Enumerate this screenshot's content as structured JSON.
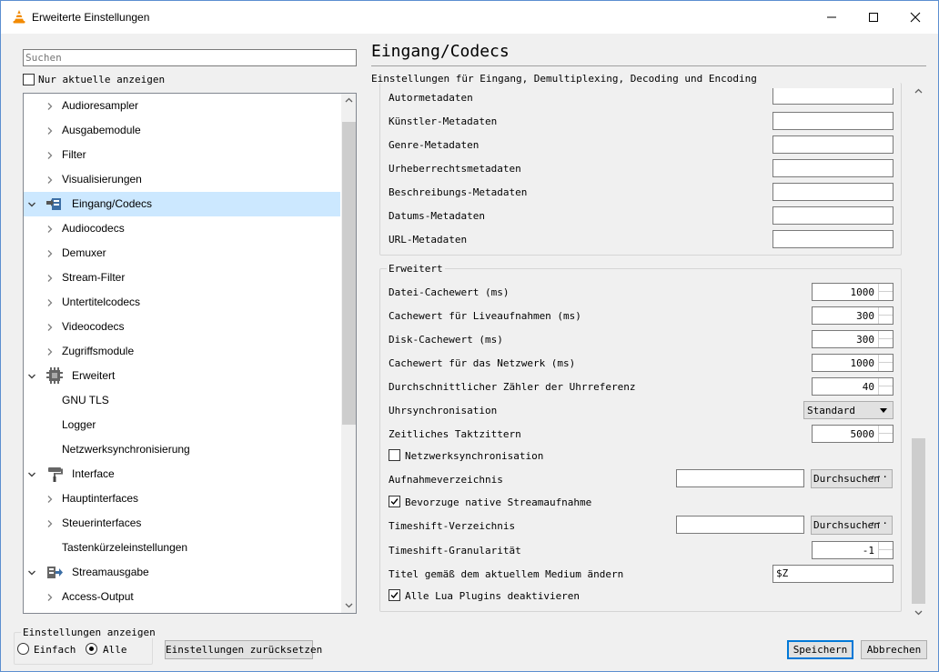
{
  "window": {
    "title": "Erweiterte Einstellungen"
  },
  "left": {
    "search_placeholder": "Suchen",
    "only_current_label": "Nur aktuelle anzeigen",
    "only_current_checked": false,
    "tree": [
      {
        "label": "Audioresampler",
        "level": 1,
        "expander": "collapsed",
        "icon": ""
      },
      {
        "label": "Ausgabemodule",
        "level": 1,
        "expander": "collapsed",
        "icon": ""
      },
      {
        "label": "Filter",
        "level": 1,
        "expander": "collapsed",
        "icon": ""
      },
      {
        "label": "Visualisierungen",
        "level": 1,
        "expander": "collapsed",
        "icon": ""
      },
      {
        "label": "Eingang/Codecs",
        "level": 0,
        "expander": "expanded",
        "icon": "input-codecs-icon",
        "selected": true
      },
      {
        "label": "Audiocodecs",
        "level": 1,
        "expander": "collapsed",
        "icon": ""
      },
      {
        "label": "Demuxer",
        "level": 1,
        "expander": "collapsed",
        "icon": ""
      },
      {
        "label": "Stream-Filter",
        "level": 1,
        "expander": "collapsed",
        "icon": ""
      },
      {
        "label": "Untertitelcodecs",
        "level": 1,
        "expander": "collapsed",
        "icon": ""
      },
      {
        "label": "Videocodecs",
        "level": 1,
        "expander": "collapsed",
        "icon": ""
      },
      {
        "label": "Zugriffsmodule",
        "level": 1,
        "expander": "collapsed",
        "icon": ""
      },
      {
        "label": "Erweitert",
        "level": 0,
        "expander": "expanded",
        "icon": "chip-icon"
      },
      {
        "label": "GNU TLS",
        "level": 1,
        "expander": "none",
        "icon": ""
      },
      {
        "label": "Logger",
        "level": 1,
        "expander": "none",
        "icon": ""
      },
      {
        "label": "Netzwerksynchronisierung",
        "level": 1,
        "expander": "none",
        "icon": ""
      },
      {
        "label": "Interface",
        "level": 0,
        "expander": "expanded",
        "icon": "paint-roller-icon"
      },
      {
        "label": "Hauptinterfaces",
        "level": 1,
        "expander": "collapsed",
        "icon": ""
      },
      {
        "label": "Steuerinterfaces",
        "level": 1,
        "expander": "collapsed",
        "icon": ""
      },
      {
        "label": "Tastenkürzeleinstellungen",
        "level": 1,
        "expander": "none",
        "icon": ""
      },
      {
        "label": "Streamausgabe",
        "level": 0,
        "expander": "expanded",
        "icon": "stream-output-icon"
      },
      {
        "label": "Access-Output",
        "level": 1,
        "expander": "collapsed",
        "icon": ""
      }
    ]
  },
  "right": {
    "title": "Eingang/Codecs",
    "subtitle": "Einstellungen für Eingang, Demultiplexing, Decoding und Encoding",
    "metadata_rows": [
      {
        "label": "Autormetadaten",
        "value": ""
      },
      {
        "label": "Künstler-Metadaten",
        "value": ""
      },
      {
        "label": "Genre-Metadaten",
        "value": ""
      },
      {
        "label": "Urheberrechtsmetadaten",
        "value": ""
      },
      {
        "label": "Beschreibungs-Metadaten",
        "value": ""
      },
      {
        "label": "Datums-Metadaten",
        "value": ""
      },
      {
        "label": "URL-Metadaten",
        "value": ""
      }
    ],
    "advanced": {
      "legend": "Erweitert",
      "file_cache_label": "Datei-Cachewert (ms)",
      "file_cache_value": "1000",
      "live_cache_label": "Cachewert für Liveaufnahmen (ms)",
      "live_cache_value": "300",
      "disk_cache_label": "Disk-Cachewert (ms)",
      "disk_cache_value": "300",
      "network_cache_label": "Cachewert für das Netzwerk (ms)",
      "network_cache_value": "1000",
      "clock_ref_label": "Durchschnittlicher Zähler der Uhrreferenz",
      "clock_ref_value": "40",
      "clock_sync_label": "Uhrsynchronisation",
      "clock_sync_value": "Standard",
      "jitter_label": "Zeitliches Taktzittern",
      "jitter_value": "5000",
      "netsync_label": "Netzwerksynchronisation",
      "netsync_checked": false,
      "record_dir_label": "Aufnahmeverzeichnis",
      "record_dir_value": "",
      "browse_label": "Durchsuchen",
      "native_record_label": "Bevorzuge native Streamaufnahme",
      "native_record_checked": true,
      "timeshift_dir_label": "Timeshift-Verzeichnis",
      "timeshift_dir_value": "",
      "timeshift_gran_label": "Timeshift-Granularität",
      "timeshift_gran_value": "-1",
      "title_change_label": "Titel gemäß dem aktuellem Medium ändern",
      "title_change_value": "$Z",
      "disable_lua_label": "Alle Lua Plugins deaktivieren",
      "disable_lua_checked": true
    }
  },
  "bottom": {
    "show_settings_label": "Einstellungen anzeigen",
    "simple_label": "Einfach",
    "all_label": "Alle",
    "selected_mode": "Alle",
    "reset_label": "Einstellungen zurücksetzen",
    "save_label": "Speichern",
    "cancel_label": "Abbrechen"
  },
  "colors": {
    "selection": "#cce8ff",
    "accent": "#0078d7",
    "vlc_orange": "#f28a00"
  }
}
